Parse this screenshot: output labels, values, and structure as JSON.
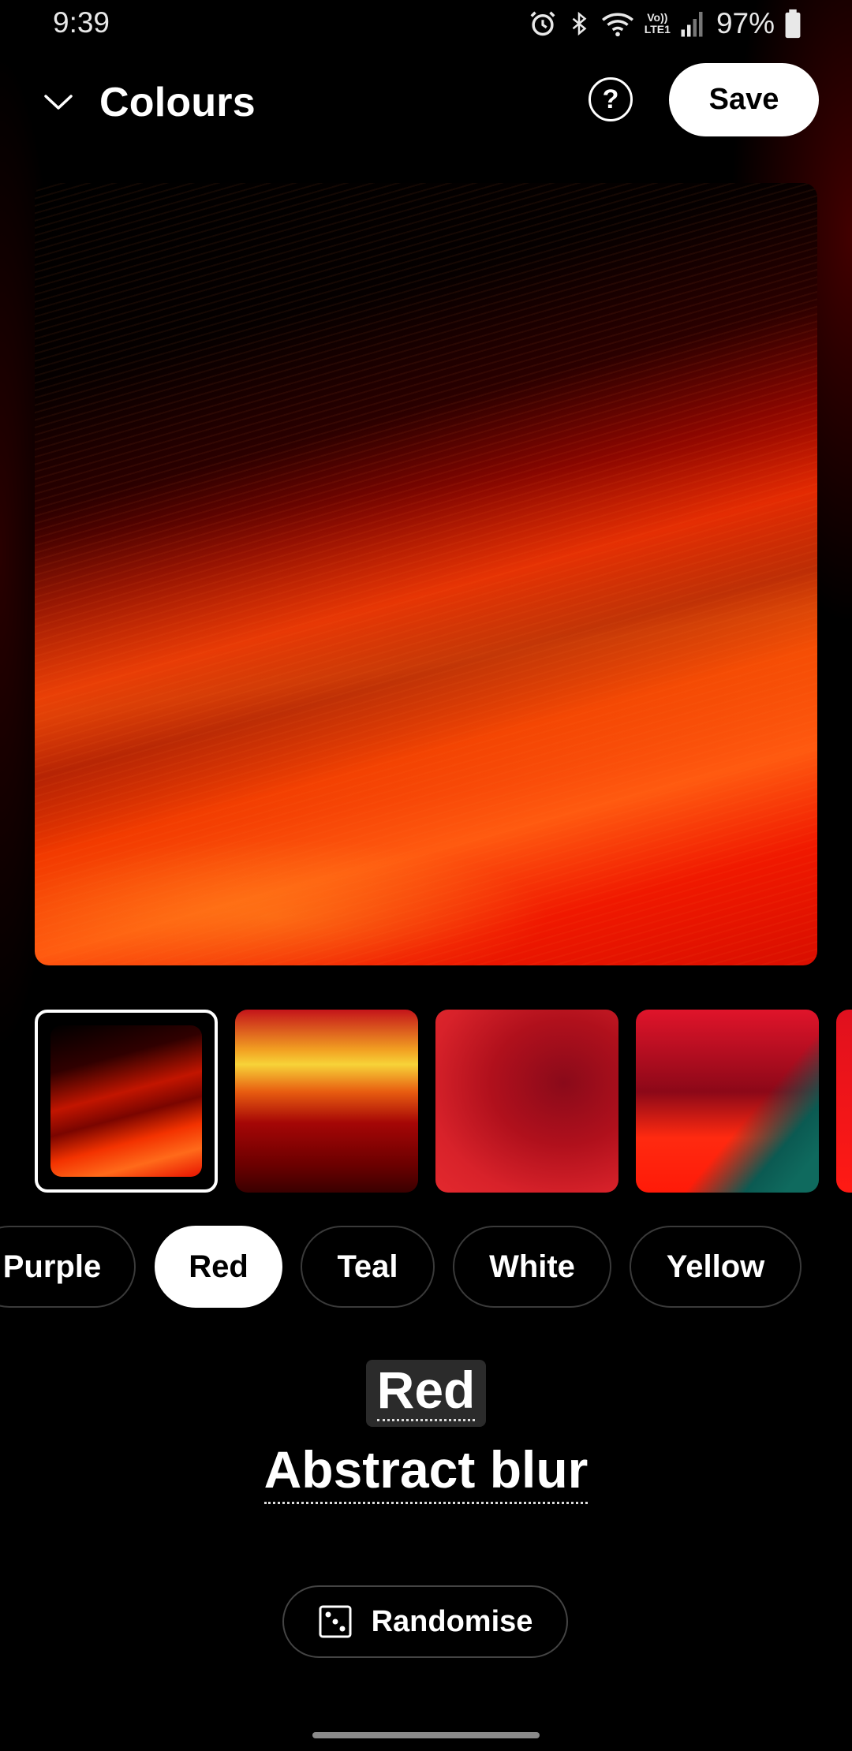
{
  "status_bar": {
    "time": "9:39",
    "icons": [
      "alarm-icon",
      "bluetooth-icon",
      "wifi-icon",
      "volte-lte-icon",
      "signal-icon",
      "battery-icon"
    ],
    "network_top": "Vo))",
    "network_bottom": "LTE1",
    "battery": "97%"
  },
  "header": {
    "title": "Colours",
    "help_symbol": "?",
    "save_label": "Save"
  },
  "preview": {
    "description_icon": "wallpaper-preview"
  },
  "thumbnails": {
    "selected_index": 0,
    "count_visible": 5
  },
  "chips": [
    {
      "label": "Purple"
    },
    {
      "label": "Red",
      "active": true
    },
    {
      "label": "Teal"
    },
    {
      "label": "White"
    },
    {
      "label": "Yellow"
    }
  ],
  "selection": {
    "colour": "Red",
    "wallpaper_name": "Abstract blur"
  },
  "randomise": {
    "label": "Randomise",
    "icon": "dice-icon"
  },
  "colors": {
    "accent": "#ffffff",
    "background": "#000000",
    "chip_border": "#3a3a3a"
  }
}
